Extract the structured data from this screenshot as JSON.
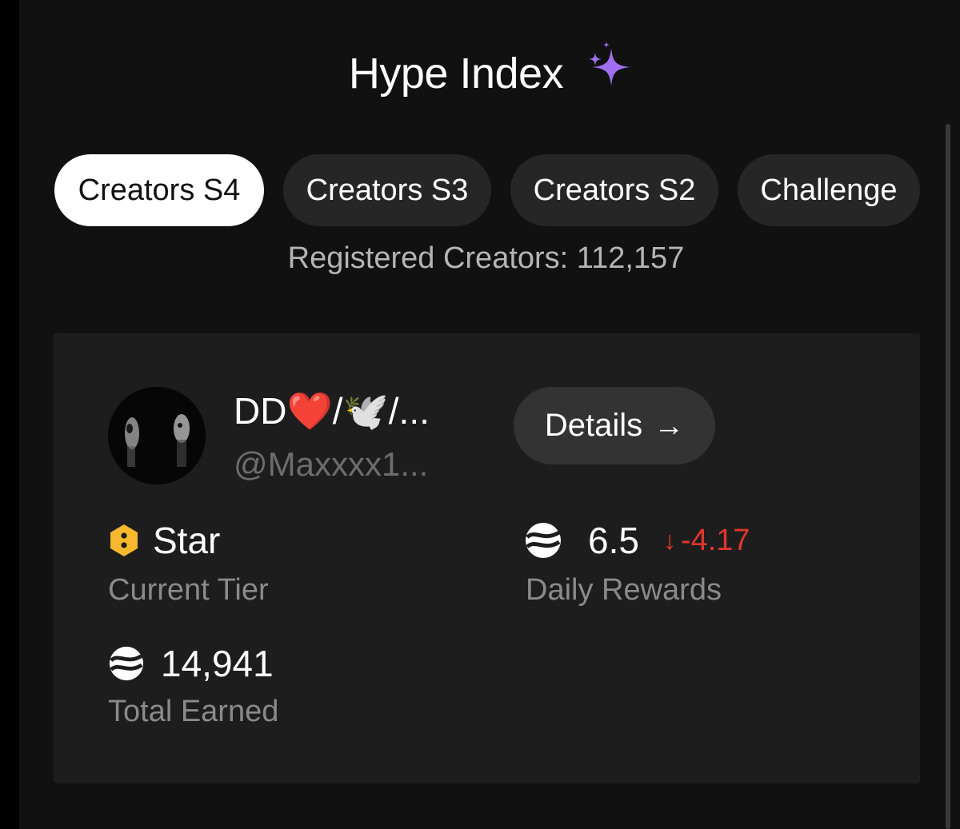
{
  "header": {
    "title": "Hype Index",
    "sparkle_icon": "sparkles-icon",
    "sparkle_color": "#a06ff0"
  },
  "tabs": [
    {
      "label": "Creators S4",
      "active": true
    },
    {
      "label": "Creators S3",
      "active": false
    },
    {
      "label": "Creators S2",
      "active": false
    },
    {
      "label": "Challenge",
      "active": false
    }
  ],
  "registered": "Registered Creators: 112,157",
  "creator": {
    "name": "DD❤️/🕊️/...",
    "handle": "@Maxxxx1...",
    "details_label": "Details",
    "details_icon": "arrow-right-icon",
    "tier": {
      "value": "Star",
      "label": "Current Tier",
      "icon": "tier-badge-icon",
      "color": "#f5b82e"
    },
    "daily_rewards": {
      "value": "6.5",
      "delta": "-4.17",
      "delta_arrow": "↓",
      "label": "Daily Rewards",
      "delta_color": "#e2362b"
    },
    "total_earned": {
      "value": "14,941",
      "label": "Total Earned"
    }
  }
}
